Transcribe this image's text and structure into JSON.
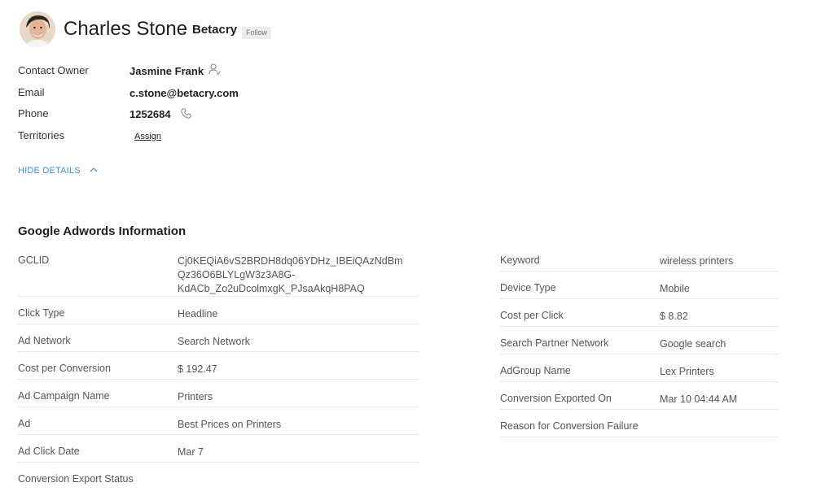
{
  "contact": {
    "name": "Charles Stone",
    "separator": "-",
    "company": "Betacry",
    "follow_label": "Follow"
  },
  "details": {
    "owner_label": "Contact Owner",
    "owner_value": "Jasmine Frank",
    "email_label": "Email",
    "email_value": "c.stone@betacry.com",
    "phone_label": "Phone",
    "phone_value": "1252684",
    "territories_label": "Territories",
    "territories_action": "Assign",
    "toggle_label": "HIDE DETAILS"
  },
  "adwords": {
    "title": "Google Adwords Information",
    "left": [
      {
        "label": "GCLID",
        "value_lines": [
          "Cj0KEQiA6vS2BRDH8dq06YDHz_IBEiQAzNdBm",
          "Qz36O6BLYLgW3z3A8G-",
          "KdACb_Zo2uDcolmxgK_PJsaAkqH8PAQ"
        ]
      },
      {
        "label": "Click Type",
        "value": "Headline"
      },
      {
        "label": "Ad Network",
        "value": "Search Network"
      },
      {
        "label": "Cost per Conversion",
        "value": "$ 192.47"
      },
      {
        "label": "Ad Campaign Name",
        "value": "Printers"
      },
      {
        "label": "Ad",
        "value": "Best Prices on Printers"
      },
      {
        "label": "Ad Click Date",
        "value": "Mar 7"
      },
      {
        "label": "Conversion Export Status",
        "value": ""
      }
    ],
    "right": [
      {
        "label": "Keyword",
        "value": "wireless printers"
      },
      {
        "label": "Device Type",
        "value": "Mobile"
      },
      {
        "label": "Cost per Click",
        "value": "$ 8.82"
      },
      {
        "label": "Search Partner Network",
        "value": "Google search"
      },
      {
        "label": "AdGroup Name",
        "value": "Lex Printers"
      },
      {
        "label": "Conversion Exported On",
        "value": "Mar 10 04:44 AM"
      },
      {
        "label": "Reason for Conversion Failure",
        "value": ""
      }
    ]
  }
}
